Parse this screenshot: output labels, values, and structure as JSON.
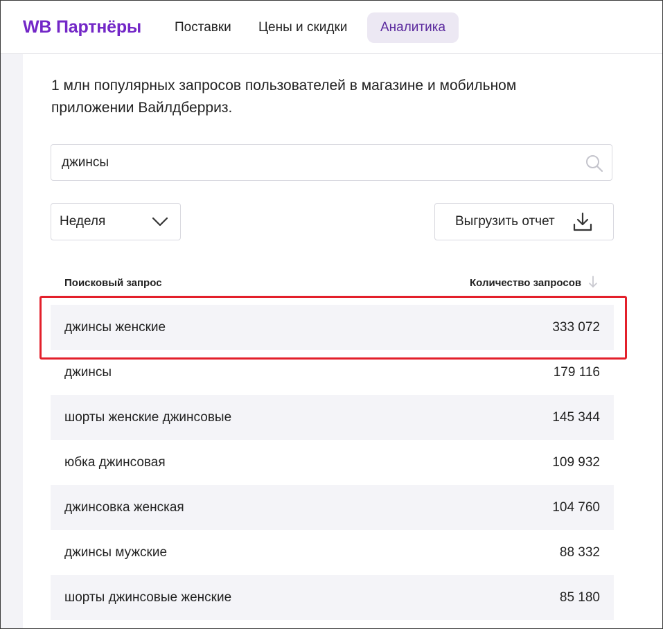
{
  "header": {
    "logo": "WB Партнёры",
    "nav": [
      {
        "label": "Поставки",
        "active": false
      },
      {
        "label": "Цены и скидки",
        "active": false
      },
      {
        "label": "Аналитика",
        "active": true
      }
    ],
    "active_color": "#5b2a9e",
    "brand_color": "#7327c7"
  },
  "main": {
    "description": "1 млн популярных запросов пользователей в магазине и мобильном приложении Вайлдберриз.",
    "search": {
      "value": "джинсы",
      "icon": "search-icon"
    },
    "period": {
      "selected": "Неделя",
      "icon": "chevron-down-icon"
    },
    "export": {
      "label": "Выгрузить отчет",
      "icon": "download-icon"
    },
    "table": {
      "columns": [
        "Поисковый запрос",
        "Количество запросов"
      ],
      "sort_icon": "arrow-down-icon",
      "rows": [
        {
          "query": "джинсы женские",
          "count": "333 072"
        },
        {
          "query": "джинсы",
          "count": "179 116"
        },
        {
          "query": "шорты женские джинсовые",
          "count": "145 344"
        },
        {
          "query": "юбка джинсовая",
          "count": "109 932"
        },
        {
          "query": "джинсовка женская",
          "count": "104 760"
        },
        {
          "query": "джинсы мужские",
          "count": "88 332"
        },
        {
          "query": "шорты джинсовые женские",
          "count": "85 180"
        }
      ]
    },
    "highlight_color": "#e3202b"
  }
}
